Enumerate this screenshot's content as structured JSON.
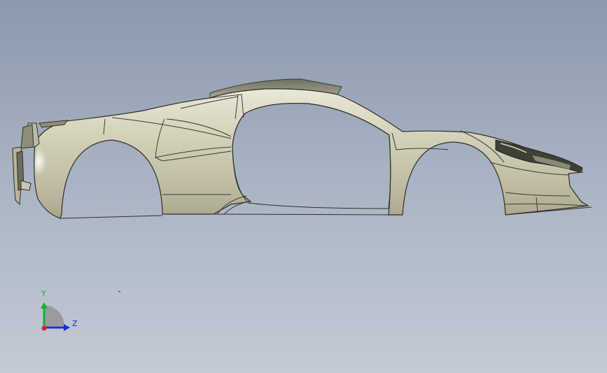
{
  "viewport": {
    "background_top": "#8b99ad",
    "background_bottom": "#c3cad5"
  },
  "model": {
    "icon": "car-body-surface-model",
    "surface_color": "#c7c4ac",
    "edge_color": "#2f3028"
  },
  "triad": {
    "y_label": "Y",
    "z_label": "Z",
    "y_color": "#0bb52b",
    "z_color": "#1f2bd6",
    "x_color": "#e0202a"
  }
}
